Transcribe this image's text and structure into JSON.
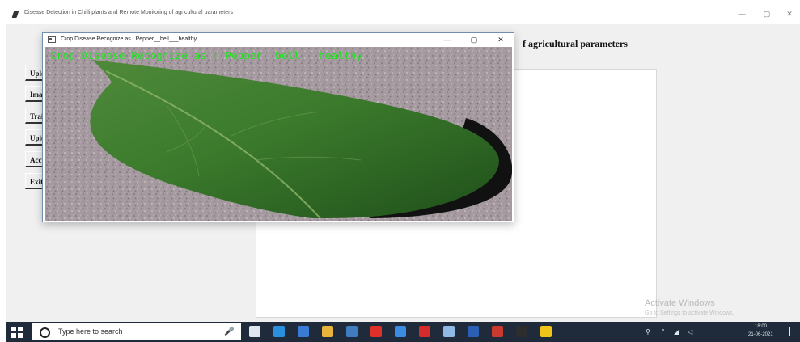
{
  "main_window": {
    "title": "Disease Detection in Chilli plants and Remote Monitoring of agricultural parameters",
    "controls": {
      "minimize": "—",
      "maximize": "▢",
      "close": "✕"
    },
    "heading_visible": "f agricultural parameters",
    "sidebar_buttons": [
      {
        "label": "Uplo"
      },
      {
        "label": "Imag"
      },
      {
        "label": "Train"
      },
      {
        "label": "Uplo"
      },
      {
        "label": "Accu"
      },
      {
        "label": "Exit"
      }
    ]
  },
  "popup": {
    "title": "Crop Disease Recognize as : Pepper__bell___healthy",
    "overlay_text": "Crop Disease Recognize as : Pepper__bell___healthy",
    "controls": {
      "minimize": "—",
      "maximize": "▢",
      "close": "✕"
    }
  },
  "watermark": {
    "title": "Activate Windows",
    "subtitle": "Go to Settings to activate Windows."
  },
  "taskbar": {
    "search_placeholder": "Type here to search",
    "apps": [
      {
        "icon": "task-view-icon",
        "color": "#dfe6ee"
      },
      {
        "icon": "edge-icon",
        "color": "#2b8fe0"
      },
      {
        "icon": "store-icon",
        "color": "#3a7bd5"
      },
      {
        "icon": "folder-icon",
        "color": "#e8b33a"
      },
      {
        "icon": "python-icon",
        "color": "#3f7cc0"
      },
      {
        "icon": "opera-icon",
        "color": "#e0302a"
      },
      {
        "icon": "photos-icon",
        "color": "#3b8be0"
      },
      {
        "icon": "pdf-icon",
        "color": "#d62b2b"
      },
      {
        "icon": "notepad-icon",
        "color": "#8fb8e6"
      },
      {
        "icon": "word-icon",
        "color": "#2b5fb3"
      },
      {
        "icon": "app-red-icon",
        "color": "#c93a2e"
      },
      {
        "icon": "terminal-icon",
        "color": "#2d2d2d"
      },
      {
        "icon": "python-idle-icon",
        "color": "#f0c419"
      }
    ],
    "clock_time": "18:00",
    "clock_date": "21-06-2021"
  }
}
